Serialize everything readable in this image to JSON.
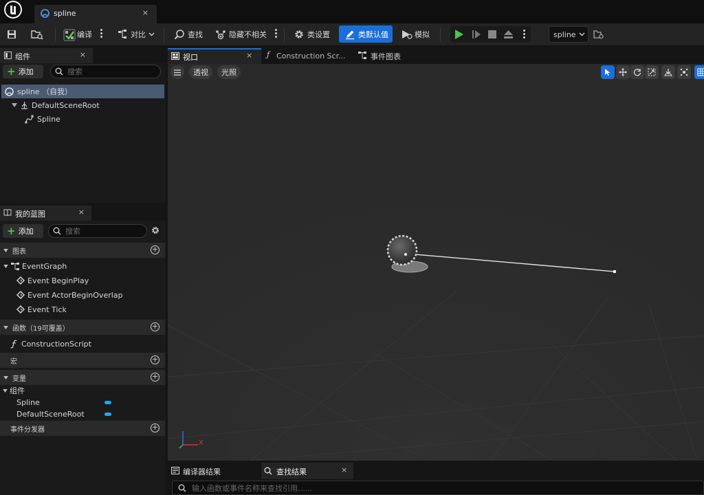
{
  "document_tab": {
    "title": "spline",
    "close": "×"
  },
  "toolbar": {
    "compile": "编译",
    "diff": "对比",
    "find": "查找",
    "hide_unrelated": "隐藏不相关",
    "class_settings": "类设置",
    "class_defaults": "类默认值",
    "simulate": "模拟",
    "debug_object": "spline"
  },
  "components_panel": {
    "title": "组件",
    "add_label": "添加",
    "search_placeholder": "搜索",
    "tree": [
      {
        "label": "spline （自我）"
      },
      {
        "label": "DefaultSceneRoot"
      },
      {
        "label": "Spline"
      }
    ]
  },
  "my_blueprint_panel": {
    "title": "我的蓝图",
    "add_label": "添加",
    "search_placeholder": "搜索",
    "sections": {
      "graphs": "图表",
      "functions": "函数（19可覆盖）",
      "macros": "宏",
      "variables": "变量",
      "dispatchers": "事件分发器"
    },
    "event_graph": "EventGraph",
    "events": [
      "Event BeginPlay",
      "Event ActorBeginOverlap",
      "Event Tick"
    ],
    "function_items": [
      "ConstructionScript"
    ],
    "variable_group": "组件",
    "variables": [
      "Spline",
      "DefaultSceneRoot"
    ]
  },
  "editor_tabs": [
    {
      "label": "视口",
      "close": "×"
    },
    {
      "label": "Construction Scr..."
    },
    {
      "label": "事件图表"
    }
  ],
  "viewport": {
    "perspective": "透视",
    "lighting": "光照",
    "axis_x": "X"
  },
  "bottom_tabs": [
    {
      "label": "编译器结果"
    },
    {
      "label": "查找结果",
      "close": "×"
    }
  ],
  "bottom_search_placeholder": "输入函数或事件名称来查找引用......",
  "colors": {
    "accent": "#1a6fd8",
    "play": "#4ec24e",
    "variable_pill": "#1ea7ff"
  }
}
